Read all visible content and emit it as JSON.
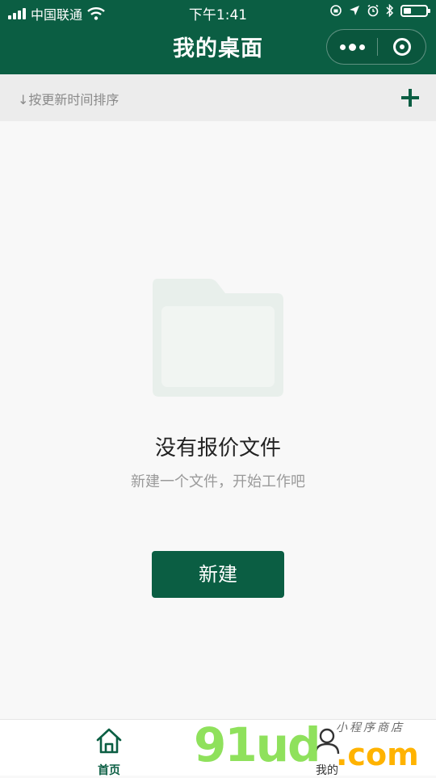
{
  "status_bar": {
    "carrier": "中国联通",
    "time": "下午1:41",
    "battery_level": 0.35
  },
  "nav": {
    "title": "我的桌面"
  },
  "sort_bar": {
    "label": "↓按更新时间排序"
  },
  "empty_state": {
    "title": "没有报价文件",
    "subtitle": "新建一个文件，开始工作吧",
    "button_label": "新建"
  },
  "tabbar": {
    "tabs": [
      {
        "label": "首页",
        "icon": "home-icon",
        "active": true
      },
      {
        "label": "我的",
        "icon": "user-icon",
        "active": false
      }
    ]
  },
  "watermark": {
    "main": "91ud",
    "suffix": ".com",
    "small": "小程序商店"
  },
  "colors": {
    "brand": "#0b5e43",
    "background": "#f8f8f8",
    "sort_bar_bg": "#ececec",
    "folder": "#e8efeb"
  }
}
